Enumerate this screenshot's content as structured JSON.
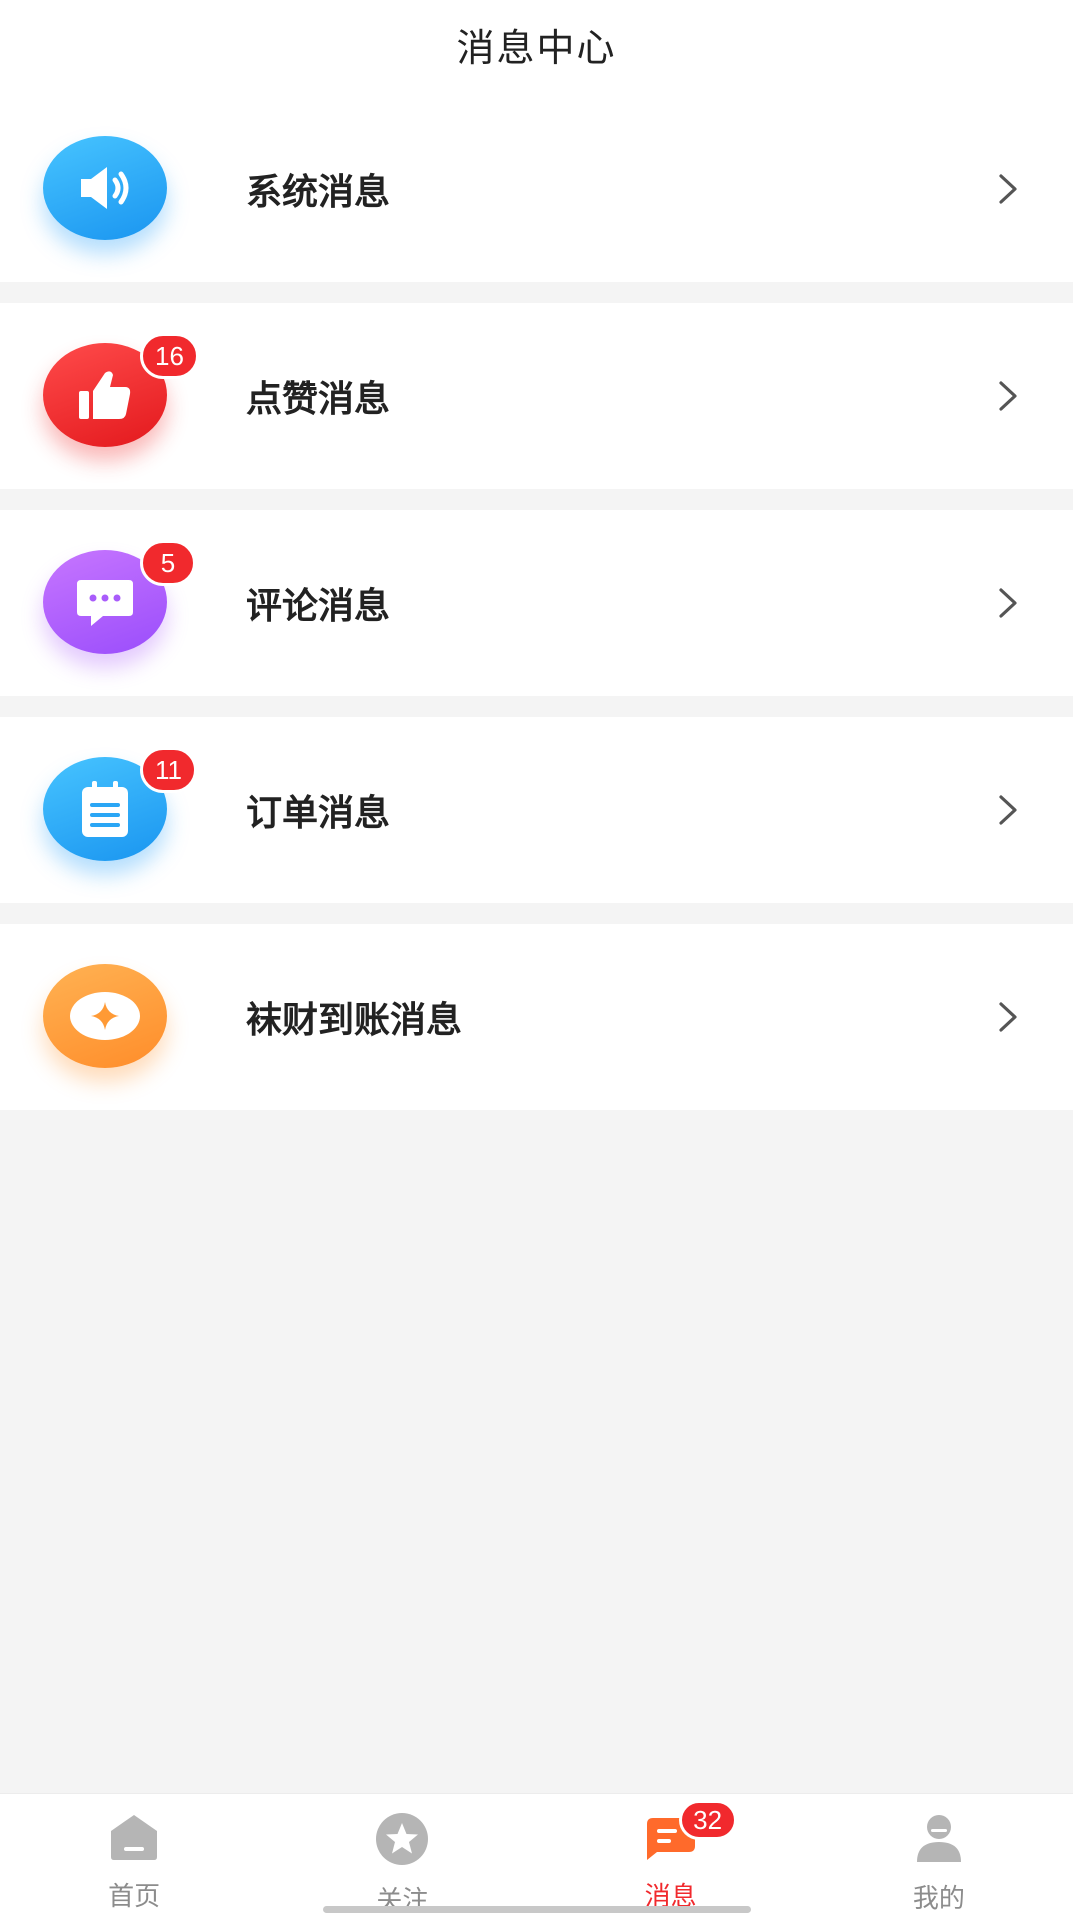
{
  "header": {
    "title": "消息中心"
  },
  "items": [
    {
      "label": "系统消息",
      "icon": "speaker-icon",
      "color": "#2aa6f5",
      "badge": null
    },
    {
      "label": "点赞消息",
      "icon": "thumbs-up-icon",
      "color": "#ee2b2b",
      "badge": "16"
    },
    {
      "label": "评论消息",
      "icon": "comment-icon",
      "color": "#a95cfb",
      "badge": "5"
    },
    {
      "label": "订单消息",
      "icon": "order-icon",
      "color": "#2aa6f5",
      "badge": "11"
    },
    {
      "label": "袜财到账消息",
      "icon": "coin-icon",
      "color": "#ff9a35",
      "badge": null
    }
  ],
  "tabbar": {
    "tabs": [
      {
        "label": "首页",
        "icon": "home-icon",
        "active": false
      },
      {
        "label": "关注",
        "icon": "star-icon",
        "active": false
      },
      {
        "label": "消息",
        "icon": "message-icon",
        "active": true,
        "badge": "32"
      },
      {
        "label": "我的",
        "icon": "profile-icon",
        "active": false
      }
    ]
  },
  "colors": {
    "accent": "#f1292d",
    "background": "#f4f4f4",
    "inactive_tab": "#8c8c8c"
  }
}
